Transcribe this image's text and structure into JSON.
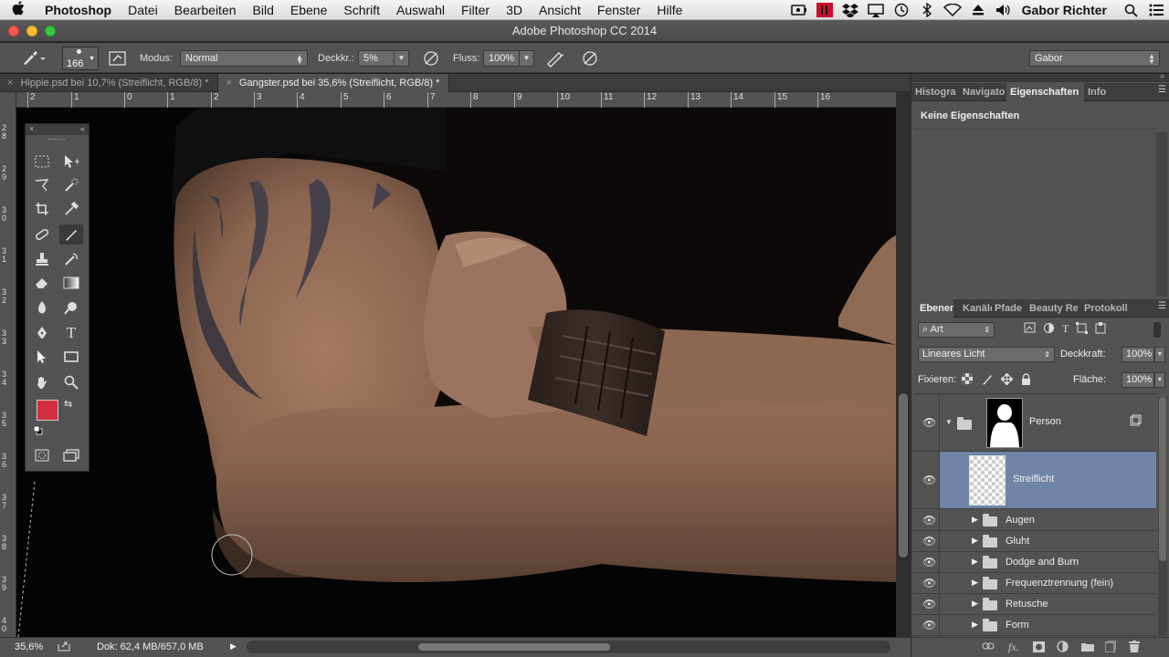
{
  "menubar": {
    "apple": "",
    "items": [
      "Photoshop",
      "Datei",
      "Bearbeiten",
      "Bild",
      "Ebene",
      "Schrift",
      "Auswahl",
      "Filter",
      "3D",
      "Ansicht",
      "Fenster",
      "Hilfe"
    ],
    "user": "Gabor Richter"
  },
  "window": {
    "title": "Adobe Photoshop CC 2014"
  },
  "options": {
    "brush_size": "166",
    "mode_label": "Modus:",
    "mode_value": "Normal",
    "opacity_label": "Deckkr.:",
    "opacity_value": "5%",
    "flow_label": "Fluss:",
    "flow_value": "100%",
    "workspace": "Gabor"
  },
  "doc_tabs": [
    {
      "label": "Hippie.psd bei 10,7% (Streiflicht, RGB/8) *",
      "active": false
    },
    {
      "label": "Gangster.psd bei 35,6% (Streiflicht, RGB/8) *",
      "active": true
    }
  ],
  "ruler_h": [
    "2",
    "1",
    "0",
    "1",
    "2",
    "3",
    "4",
    "5",
    "6",
    "7",
    "8",
    "9",
    "10",
    "11",
    "12",
    "13",
    "14",
    "15",
    "16"
  ],
  "ruler_v": [
    "2 8",
    "2 9",
    "3 0",
    "3 1",
    "3 2",
    "3 3",
    "3 4",
    "3 5",
    "3 6",
    "3 7",
    "3 8",
    "3 9",
    "4 0"
  ],
  "status": {
    "zoom": "35,6%",
    "doc": "Dok: 62,4 MB/657,0 MB"
  },
  "colors": {
    "foreground": "#d42f3f",
    "background": "#000000",
    "selected_layer": "#6f84a6"
  },
  "panels_top": {
    "tabs": [
      "Histogra",
      "Navigato",
      "Eigenschaften",
      "Info"
    ],
    "active": 2,
    "content": "Keine Eigenschaften"
  },
  "layers_panel": {
    "tabs": [
      "Ebenen",
      "Kanäle",
      "Pfade",
      "Beauty Rei",
      "Protokoll"
    ],
    "filter_label": "Art",
    "blend_mode": "Lineares Licht",
    "opacity_label": "Deckkraft:",
    "opacity_value": "100%",
    "lock_label": "Fixieren:",
    "fill_label": "Fläche:",
    "fill_value": "100%",
    "layers": [
      {
        "name": "Person",
        "type": "group-expanded"
      },
      {
        "name": "Streiflicht",
        "type": "layer",
        "selected": true
      },
      {
        "name": "Augen",
        "type": "group"
      },
      {
        "name": "Gluht",
        "type": "group"
      },
      {
        "name": "Dodge and Burn",
        "type": "group"
      },
      {
        "name": "Frequenztrennung (fein)",
        "type": "group"
      },
      {
        "name": "Retusche",
        "type": "group"
      },
      {
        "name": "Form",
        "type": "group"
      }
    ]
  }
}
